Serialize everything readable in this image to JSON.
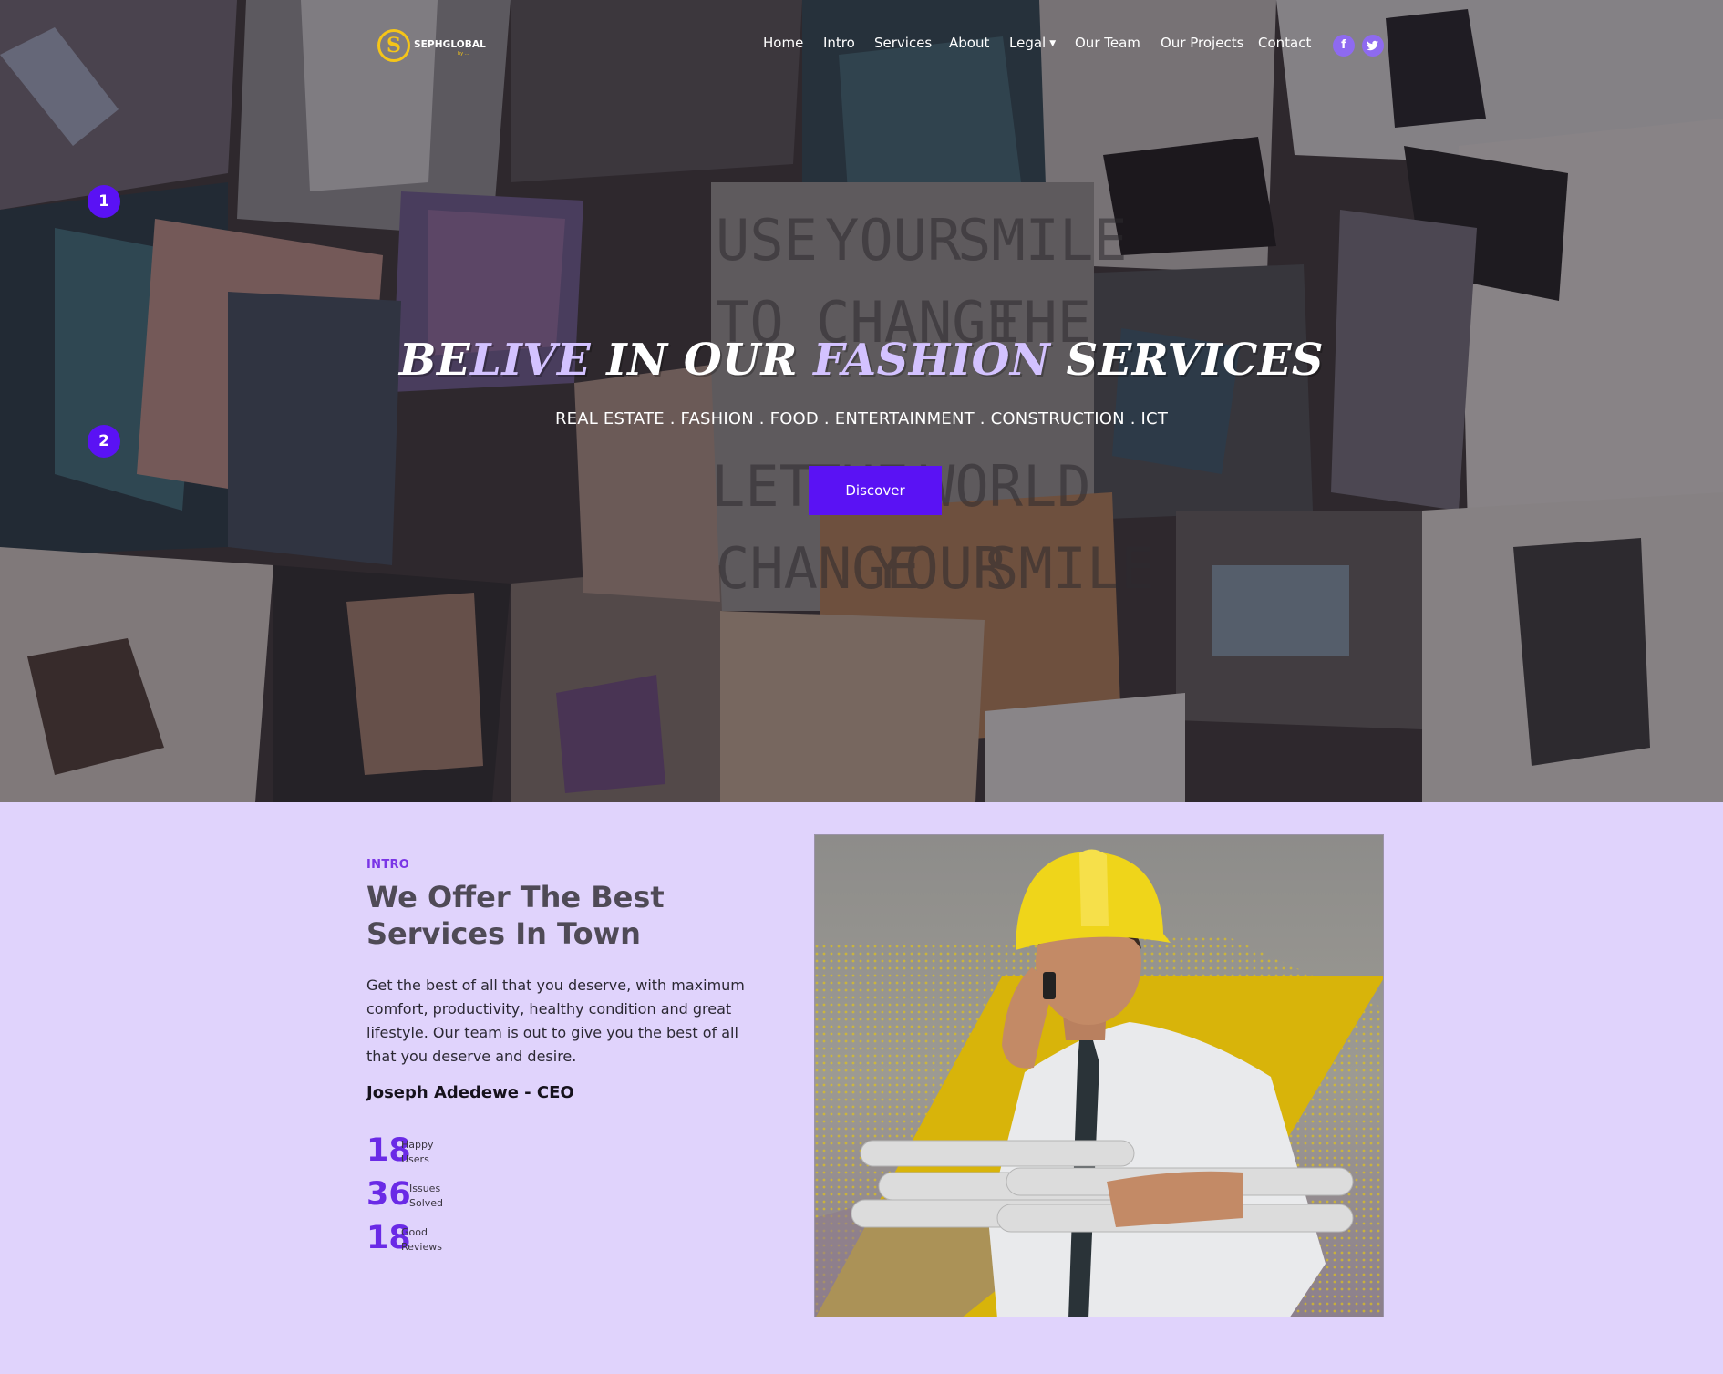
{
  "brand": {
    "logo_mark": "S",
    "name": "SEPHGLOBAL",
    "tagline": "by ..."
  },
  "nav": {
    "items": [
      "Home",
      "Intro",
      "Services",
      "About",
      "Legal",
      "Our Team",
      "Our Projects",
      "Contact"
    ],
    "legal_has_dropdown": true
  },
  "social": {
    "facebook_icon": "f",
    "twitter_icon": "t"
  },
  "slider": {
    "indicators": [
      "1",
      "2"
    ]
  },
  "hero": {
    "title_part_1": "BE",
    "title_part_2": "LIVE",
    "title_part_3": " IN OUR ",
    "title_part_4": "FASHION",
    "title_part_5": " SERVICES",
    "subtitle": "REAL ESTATE . FASHION . FOOD . ENTERTAINMENT . CONSTRUCTION . ICT",
    "cta_label": "Discover",
    "background_collage_words": [
      "USE",
      "YOUR",
      "SMILE",
      "TO",
      "CHANGE",
      "THE",
      "LET",
      "THE",
      "WORLD",
      "CHANGE",
      "YOUR",
      "SMILE"
    ]
  },
  "intro": {
    "eyebrow": "INTRO",
    "title": "We Offer The Best Services In Town",
    "body": "Get the best of all that you deserve, with maximum comfort, productivity, healthy condition and great lifestyle. Our team is out to give you the best of all that you deserve and desire.",
    "signature": "Joseph Adedewe - CEO",
    "stats": [
      {
        "value": "18",
        "line1": "Happy",
        "line2": "Users"
      },
      {
        "value": "36",
        "line1": "Issues",
        "line2": "Solved"
      },
      {
        "value": "18",
        "line1": "Good",
        "line2": "Reviews"
      }
    ]
  },
  "colors": {
    "accent_purple": "#5a12f4",
    "intro_background": "#e0d3fc",
    "hero_title_accent": "#d3c2ff",
    "logo_gold": "#f5c518"
  }
}
